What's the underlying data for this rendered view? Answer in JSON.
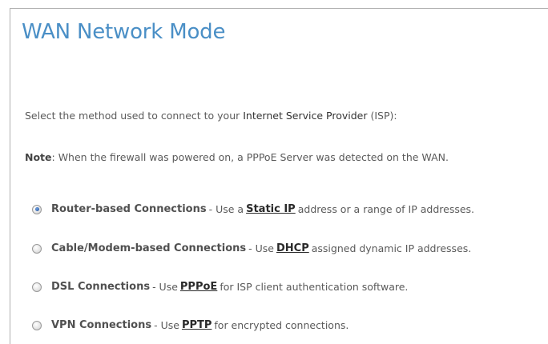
{
  "page": {
    "title": "WAN Network Mode"
  },
  "intro": {
    "prefix": "Select the method used to connect to your ",
    "isp_name": "Internet Service Provider",
    "suffix": " (ISP):"
  },
  "note": {
    "label": "Note",
    "text": ": When the firewall was powered on, a PPPoE Server was detected on the WAN."
  },
  "options": [
    {
      "selected": true,
      "title": "Router-based Connections",
      "desc_prefix": "- Use a",
      "link": "Static IP",
      "desc_suffix": "address or a range of IP addresses."
    },
    {
      "selected": false,
      "title": "Cable/Modem-based Connections",
      "desc_prefix": "- Use",
      "link": "DHCP",
      "desc_suffix": "assigned dynamic IP addresses."
    },
    {
      "selected": false,
      "title": "DSL Connections",
      "desc_prefix": "- Use",
      "link": "PPPoE",
      "desc_suffix": "for ISP client authentication software."
    },
    {
      "selected": false,
      "title": "VPN Connections",
      "desc_prefix": "- Use",
      "link": "PPTP",
      "desc_suffix": "for encrypted connections."
    }
  ],
  "colors": {
    "title": "#4a8fc6",
    "text": "#5a5a5a",
    "radio_selected": "#1f4f9a"
  }
}
